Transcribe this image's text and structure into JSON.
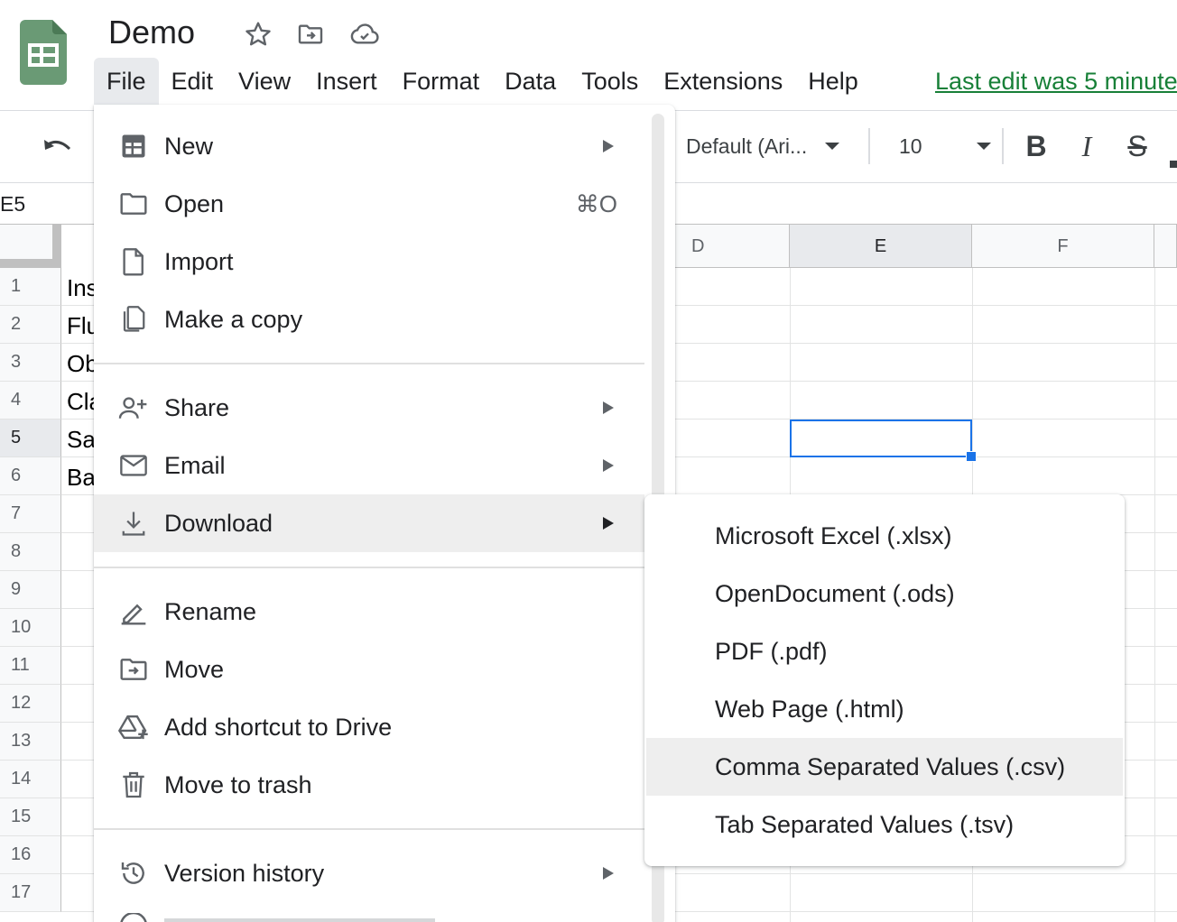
{
  "document": {
    "title": "Demo"
  },
  "menubar": {
    "items": [
      {
        "label": "File",
        "active": true
      },
      {
        "label": "Edit"
      },
      {
        "label": "View"
      },
      {
        "label": "Insert"
      },
      {
        "label": "Format"
      },
      {
        "label": "Data"
      },
      {
        "label": "Tools"
      },
      {
        "label": "Extensions"
      },
      {
        "label": "Help"
      }
    ],
    "last_edit": "Last edit was 5 minute"
  },
  "toolbar": {
    "font": "Default (Ari...",
    "font_size": "10",
    "bold": "B",
    "italic": "I",
    "strike": "S"
  },
  "name_box": "E5",
  "columns": [
    "D",
    "E",
    "F"
  ],
  "rows": [
    "1",
    "2",
    "3",
    "4",
    "5",
    "6",
    "7",
    "8",
    "9",
    "10",
    "11",
    "12",
    "13",
    "14",
    "15",
    "16",
    "17"
  ],
  "column_a_visible": [
    "Ins",
    "Flu",
    "Ob",
    "Cla",
    "Sa",
    "Ba"
  ],
  "file_menu": {
    "items": [
      {
        "label": "New",
        "icon": "new-sheet-icon",
        "submenu": true
      },
      {
        "label": "Open",
        "icon": "folder-icon",
        "shortcut": "⌘O"
      },
      {
        "label": "Import",
        "icon": "file-icon"
      },
      {
        "label": "Make a copy",
        "icon": "copy-icon"
      },
      {
        "label": "Share",
        "icon": "person-add-icon",
        "submenu": true
      },
      {
        "label": "Email",
        "icon": "email-icon",
        "submenu": true
      },
      {
        "label": "Download",
        "icon": "download-icon",
        "submenu": true,
        "hover": true
      },
      {
        "label": "Rename",
        "icon": "rename-icon"
      },
      {
        "label": "Move",
        "icon": "move-folder-icon"
      },
      {
        "label": "Add shortcut to Drive",
        "icon": "drive-shortcut-icon"
      },
      {
        "label": "Move to trash",
        "icon": "trash-icon"
      },
      {
        "label": "Version history",
        "icon": "history-icon",
        "submenu": true
      }
    ]
  },
  "download_submenu": {
    "items": [
      {
        "label": "Microsoft Excel (.xlsx)"
      },
      {
        "label": "OpenDocument (.ods)"
      },
      {
        "label": "PDF (.pdf)"
      },
      {
        "label": "Web Page (.html)"
      },
      {
        "label": "Comma Separated Values (.csv)",
        "hover": true
      },
      {
        "label": "Tab Separated Values (.tsv)"
      }
    ]
  },
  "colors": {
    "sheets_green": "#23a566",
    "logo_green": "#6a9a75",
    "selection_blue": "#1a73e8",
    "link_green": "#188038"
  }
}
